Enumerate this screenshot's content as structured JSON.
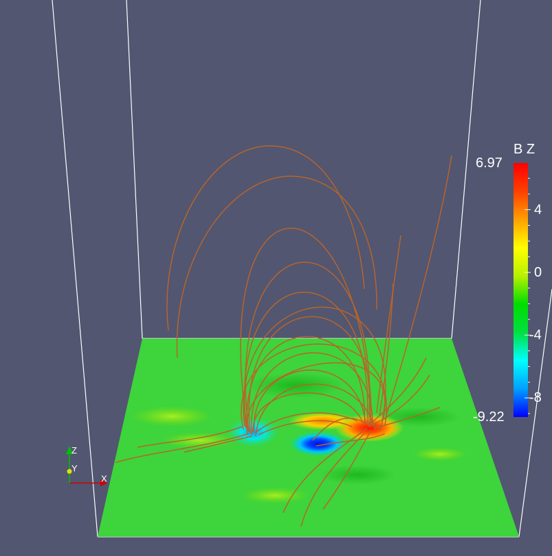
{
  "colorbar": {
    "title": "B Z",
    "max_label": "6.97",
    "min_label": "-9.22",
    "range": [
      -9.22,
      6.97
    ],
    "ticks": [
      {
        "value": 4,
        "label": "4"
      },
      {
        "value": 0,
        "label": "0"
      },
      {
        "value": -4,
        "label": "-4"
      },
      {
        "value": -8,
        "label": "-8"
      }
    ],
    "colormap": [
      "#0000ff",
      "#00a0ff",
      "#00ffff",
      "#00e040",
      "#00dd00",
      "#b8f000",
      "#ffff00",
      "#ffa000",
      "#ff4000",
      "#ff0000"
    ]
  },
  "orientation_axes": {
    "x": "X",
    "y": "Y",
    "z": "Z",
    "x_color": "#d00000",
    "y_color": "#e0e000",
    "z_color": "#00c000"
  },
  "colors": {
    "background": "#525670",
    "field_lines": "#b8642a",
    "bounding_box": "#ffffff",
    "plane": "#3cd23c"
  }
}
